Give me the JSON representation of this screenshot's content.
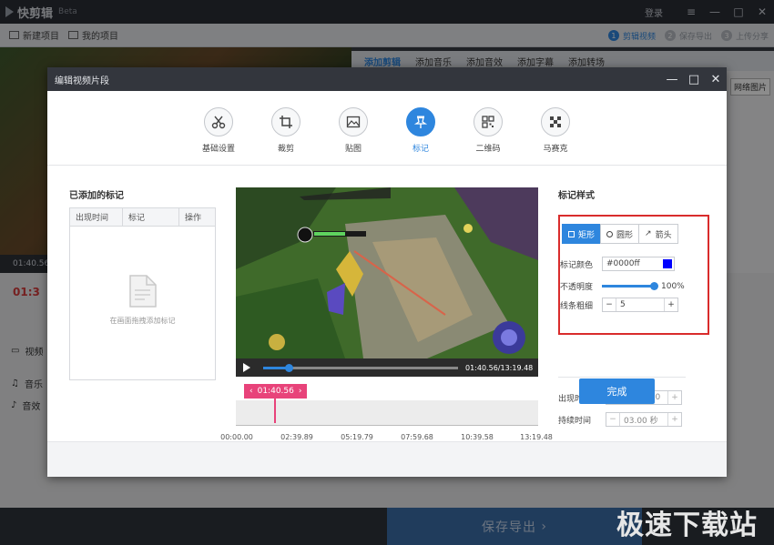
{
  "app": {
    "name": "快剪辑",
    "badge": "Beta",
    "login": "登录",
    "toolbar": {
      "new_project": "新建项目",
      "my_projects": "我的项目"
    },
    "steps": [
      {
        "num": "1",
        "label": "剪辑视频"
      },
      {
        "num": "2",
        "label": "保存导出"
      },
      {
        "num": "3",
        "label": "上传分享"
      }
    ],
    "tabs": [
      "添加剪辑",
      "添加音乐",
      "添加音效",
      "添加字幕",
      "添加转场"
    ],
    "net_image": "网络图片",
    "video_time": "01:40.56",
    "timeline_time": "01:3",
    "tracks": {
      "video": "视频",
      "music": "音乐",
      "sfx": "音效"
    },
    "save_export": "保存导出",
    "watermark": "极速下载站"
  },
  "dialog": {
    "title": "编辑视频片段",
    "tools": [
      {
        "label": "基础设置",
        "icon": "scissors-icon"
      },
      {
        "label": "裁剪",
        "icon": "crop-icon"
      },
      {
        "label": "贴图",
        "icon": "image-icon"
      },
      {
        "label": "标记",
        "icon": "pin-icon"
      },
      {
        "label": "二维码",
        "icon": "qrcode-icon"
      },
      {
        "label": "马赛克",
        "icon": "mosaic-icon"
      }
    ],
    "active_tool": "标记",
    "marks": {
      "title": "已添加的标记",
      "columns": [
        "出现时间",
        "标记",
        "操作"
      ],
      "empty_hint": "在画面拖拽添加标记"
    },
    "player": {
      "time": "01:40.56/13:19.48",
      "progress": 0.13,
      "current_flag": "01:40.56",
      "ticks": [
        "00:00.00",
        "02:39.89",
        "05:19.79",
        "07:59.68",
        "10:39.58",
        "13:19.48"
      ]
    },
    "style": {
      "title": "标记样式",
      "shapes": [
        "矩形",
        "圆形",
        "箭头"
      ],
      "active_shape": "矩形",
      "color_label": "标记颜色",
      "color_value": "#0000ff",
      "color_swatch": "#0000ff",
      "opacity_label": "不透明度",
      "opacity_value": "100%",
      "line_label": "线条粗细",
      "line_value": "5"
    },
    "timing": {
      "appear_label": "出现时间",
      "appear_value": "00:00.00",
      "duration_label": "持续时间",
      "duration_value": "03.00 秒"
    },
    "done": "完成"
  },
  "colors": {
    "accent": "#2e86de",
    "highlight": "#d92c2c",
    "flag": "#e8437a"
  }
}
